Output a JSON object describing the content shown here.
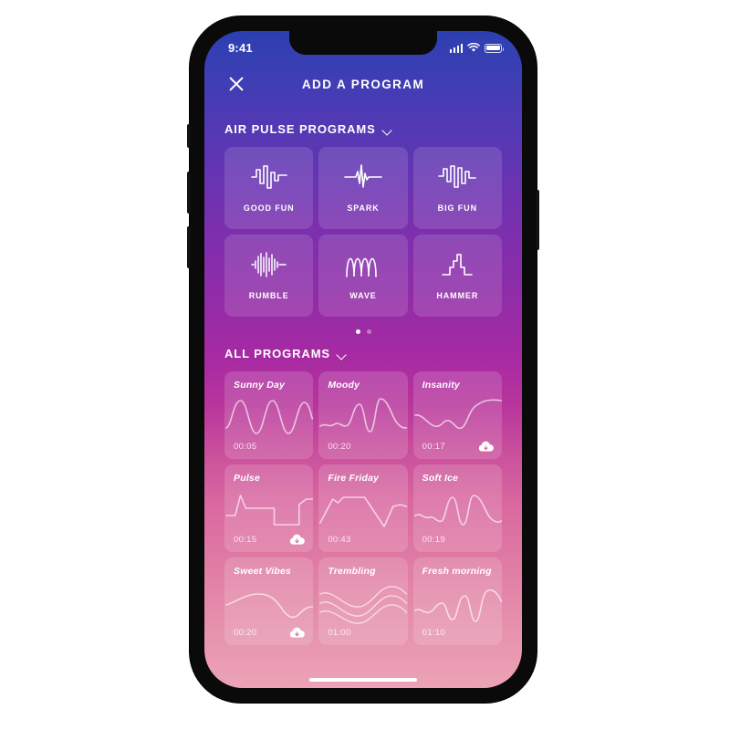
{
  "status_bar": {
    "time": "9:41",
    "signal_icon": "cellular-signal-icon",
    "wifi_icon": "wifi-icon",
    "battery_icon": "battery-icon"
  },
  "nav": {
    "close_icon": "close-icon",
    "title": "ADD A PROGRAM"
  },
  "air_pulse": {
    "section_title": "AIR PULSE PROGRAMS",
    "chevron_icon": "chevron-down-icon",
    "tiles": [
      {
        "label": "GOOD FUN",
        "icon": "waveform-good-fun-icon"
      },
      {
        "label": "SPARK",
        "icon": "waveform-spark-icon"
      },
      {
        "label": "BIG FUN",
        "icon": "waveform-big-fun-icon"
      },
      {
        "label": "RUMBLE",
        "icon": "waveform-rumble-icon"
      },
      {
        "label": "WAVE",
        "icon": "waveform-wave-icon"
      },
      {
        "label": "HAMMER",
        "icon": "waveform-hammer-icon"
      }
    ],
    "pagination": {
      "total": 2,
      "active": 1
    }
  },
  "all_programs": {
    "section_title": "ALL PROGRAMS",
    "chevron_icon": "chevron-down-icon",
    "cards": [
      {
        "name": "Sunny Day",
        "duration": "00:05",
        "cloud": false
      },
      {
        "name": "Moody",
        "duration": "00:20",
        "cloud": false
      },
      {
        "name": "Insanity",
        "duration": "00:17",
        "cloud": true
      },
      {
        "name": "Pulse",
        "duration": "00:15",
        "cloud": true
      },
      {
        "name": "Fire Friday",
        "duration": "00:43",
        "cloud": false
      },
      {
        "name": "Soft Ice",
        "duration": "00:19",
        "cloud": false
      },
      {
        "name": "Sweet Vibes",
        "duration": "00:20",
        "cloud": true
      },
      {
        "name": "Trembling",
        "duration": "01:00",
        "cloud": false
      },
      {
        "name": "Fresh morning",
        "duration": "01:10",
        "cloud": false
      }
    ]
  },
  "colors": {
    "gradient_top": "#2c3fb0",
    "gradient_mid": "#a82aa2",
    "gradient_bottom": "#eca3b6",
    "text": "#ffffff"
  },
  "home_indicator": "home-indicator"
}
